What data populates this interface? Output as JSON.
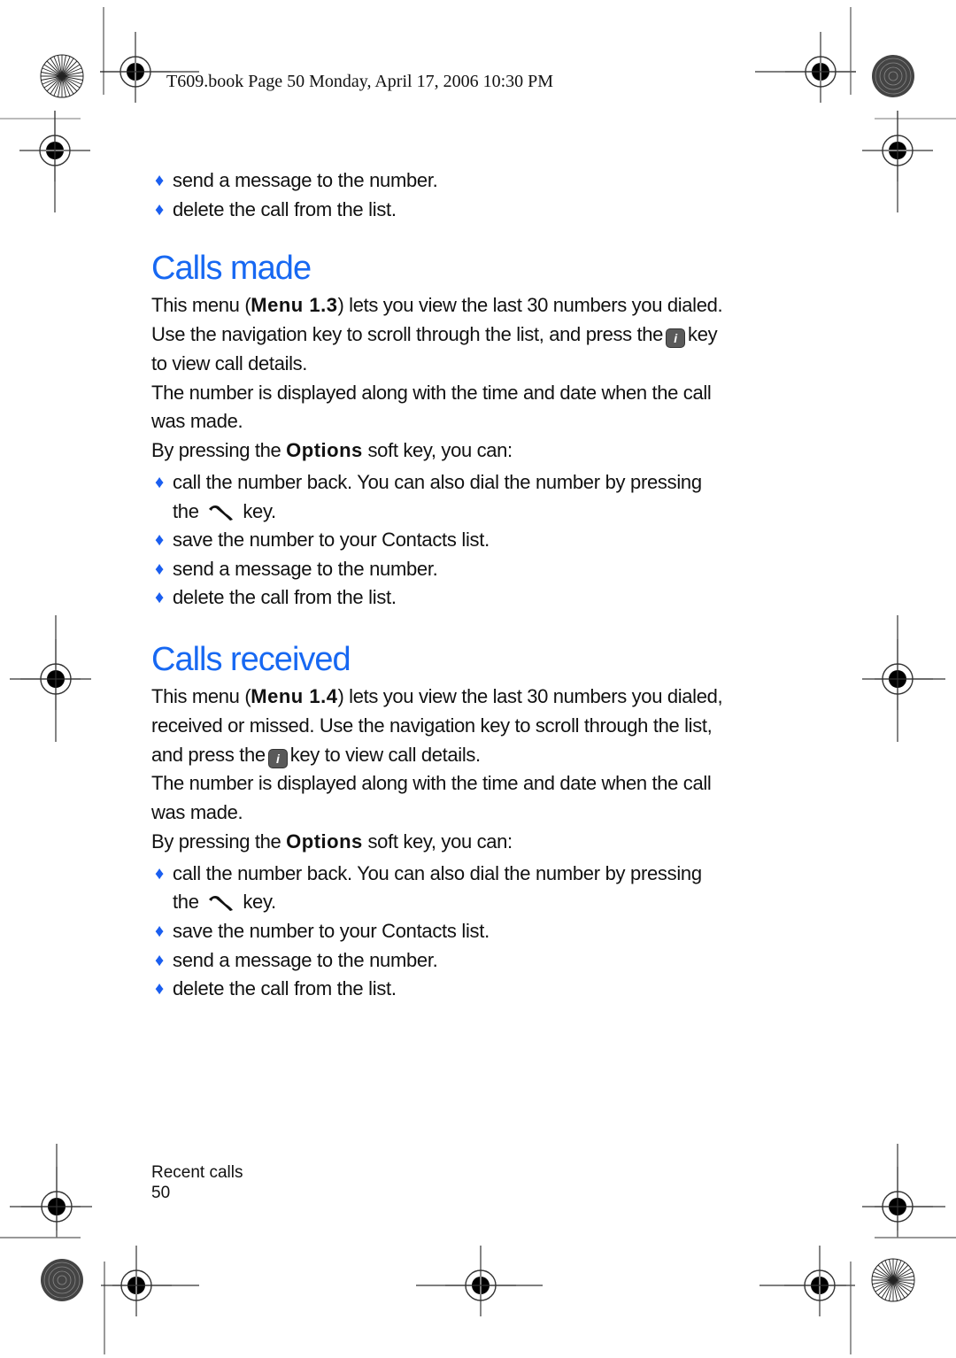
{
  "header": {
    "text": "T609.book  Page 50  Monday, April 17, 2006  10:30 PM"
  },
  "top_bullets": [
    "send a message to the number.",
    "delete the call from the list."
  ],
  "sections": [
    {
      "title": "Calls made",
      "para1": {
        "pre": "This menu (",
        "menu": "Menu 1.3",
        "post": ") lets you view the last 30 numbers you dialed.",
        "line2_pre": "Use the navigation key to scroll through the list, and press the",
        "line2_post": "key",
        "line3": "to view call details."
      },
      "para2": [
        "The number is displayed along with the time and date when the call",
        "was made."
      ],
      "options": {
        "pre": "By pressing the ",
        "key": "Options",
        "post": " soft key, you can:"
      },
      "bullets": {
        "call_line1": "call the number back. You can also dial the number by pressing",
        "call_line2_pre": "the",
        "call_line2_post": "key.",
        "save": "save the number to your Contacts list.",
        "send": "send a message to the number.",
        "delete": "delete the call from the list."
      }
    },
    {
      "title": "Calls received",
      "para1": {
        "pre": "This menu (",
        "menu": "Menu 1.4",
        "post": ") lets you view the last 30 numbers you dialed,",
        "line2": "received or missed. Use the navigation key to scroll through the list,",
        "line3_pre": "and press the",
        "line3_post": "key to view call details."
      },
      "para2": [
        "The number is displayed along with the time and date when the call",
        "was made."
      ],
      "options": {
        "pre": "By pressing the ",
        "key": "Options",
        "post": " soft key, you can:"
      },
      "bullets": {
        "call_line1": "call the number back. You can also dial the number by pressing",
        "call_line2_pre": "the",
        "call_line2_post": "key.",
        "save": "save the number to your Contacts list.",
        "send": "send a message to the number.",
        "delete": "delete the call from the list."
      }
    }
  ],
  "icons": {
    "info_key": "i",
    "bullet_glyph": "♦"
  },
  "footer": {
    "section": "Recent calls",
    "page_number": "50"
  },
  "colors": {
    "heading": "#1768f2",
    "bullet": "#1a5ef0",
    "text": "#111111"
  }
}
